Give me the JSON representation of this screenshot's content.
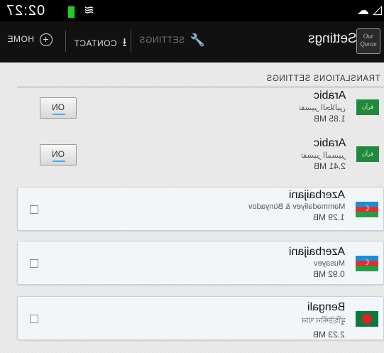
{
  "status_bar": {
    "time": "02:27",
    "battery_color": "#20d020",
    "icons": [
      "wifi-icon",
      "cloud-upload-icon",
      "graph-icon"
    ]
  },
  "action_bar": {
    "title": "Settings",
    "logo_text": "Our Quran",
    "home_label": "HOME",
    "contact_label": "CONTACT",
    "settings_label": "SETTINGS"
  },
  "section": {
    "title": "TRANSLATIONS SETTINGS"
  },
  "translations": [
    {
      "name": "Arabic",
      "sub": "تفسير الجلالين",
      "size": "1.85 MB",
      "flag": "saudi-arabia-flag",
      "control": "toggle",
      "toggle_label": "ON"
    },
    {
      "name": "Arabic",
      "sub": "تفسير المسير",
      "size": "2.41 MB",
      "flag": "saudi-arabia-flag",
      "control": "toggle",
      "toggle_label": "ON"
    },
    {
      "name": "Azerbaijani",
      "sub": "Məmmədəliyev & Bünyadov",
      "size": "1.29 MB",
      "flag": "azerbaijan-flag",
      "control": "checkbox",
      "checked": false
    },
    {
      "name": "Azerbaijani",
      "sub": "Musayev",
      "size": "0.92 MB",
      "flag": "azerbaijan-flag",
      "control": "checkbox",
      "checked": false
    },
    {
      "name": "Bengali",
      "sub": "মুহিউদ্দীন খান",
      "size": "2.23 MB",
      "flag": "bangladesh-flag",
      "control": "checkbox",
      "checked": false
    }
  ],
  "colors": {
    "accent": "#33b5e5",
    "action_bar_bg": "#111111",
    "card_bg": "#f3f6f9"
  }
}
